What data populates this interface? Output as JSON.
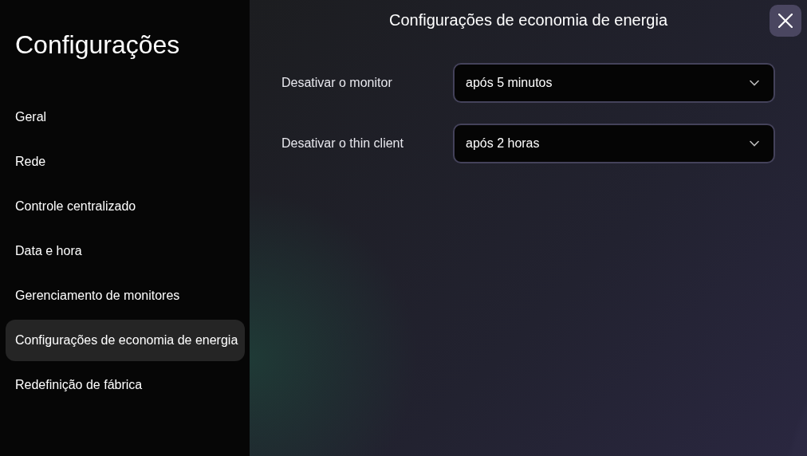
{
  "sidebar": {
    "title": "Configurações",
    "items": [
      {
        "label": "Geral",
        "selected": false
      },
      {
        "label": "Rede",
        "selected": false
      },
      {
        "label": "Controle centralizado",
        "selected": false
      },
      {
        "label": "Data e hora",
        "selected": false
      },
      {
        "label": "Gerenciamento de monitores",
        "selected": false
      },
      {
        "label": "Configurações de economia de energia",
        "selected": true
      },
      {
        "label": "Redefinição de fábrica",
        "selected": false
      }
    ]
  },
  "panel": {
    "title": "Configurações de economia de energia",
    "settings": [
      {
        "label": "Desativar o monitor",
        "value": "após 5 minutos"
      },
      {
        "label": "Desativar o thin client",
        "value": "após 2 horas"
      }
    ]
  }
}
